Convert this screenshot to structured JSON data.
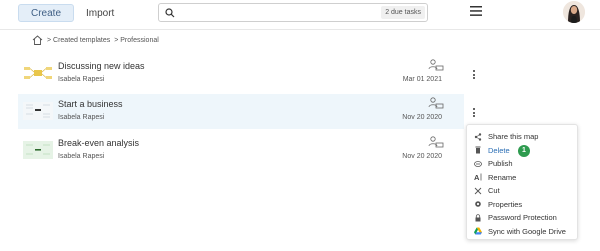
{
  "toolbar": {
    "create_label": "Create",
    "import_label": "Import",
    "search_placeholder": "",
    "due_tasks": "2 due tasks"
  },
  "breadcrumb": {
    "items": [
      "> Created templates",
      "> Professional"
    ]
  },
  "files": [
    {
      "title": "Discussing new ideas",
      "author": "Isabela Rapesi",
      "date": "Mar 01 2021"
    },
    {
      "title": "Start a business",
      "author": "Isabela Rapesi",
      "date": "Nov 20 2020"
    },
    {
      "title": "Break-even analysis",
      "author": "Isabela Rapesi",
      "date": "Nov 20 2020"
    }
  ],
  "context_menu": {
    "items": [
      {
        "label": "Share this map",
        "icon": "share-icon"
      },
      {
        "label": "Delete",
        "icon": "trash-icon",
        "badge": "1"
      },
      {
        "label": "Publish",
        "icon": "publish-icon"
      },
      {
        "label": "Rename",
        "icon": "rename-icon"
      },
      {
        "label": "Cut",
        "icon": "cut-icon"
      },
      {
        "label": "Properties",
        "icon": "gear-icon"
      },
      {
        "label": "Password Protection",
        "icon": "lock-icon"
      },
      {
        "label": "Sync with Google Drive",
        "icon": "google-drive-icon"
      }
    ]
  },
  "colors": {
    "accent": "#2c6fb5",
    "selected_row": "#eef6fb",
    "badge": "#2e9b4f"
  }
}
